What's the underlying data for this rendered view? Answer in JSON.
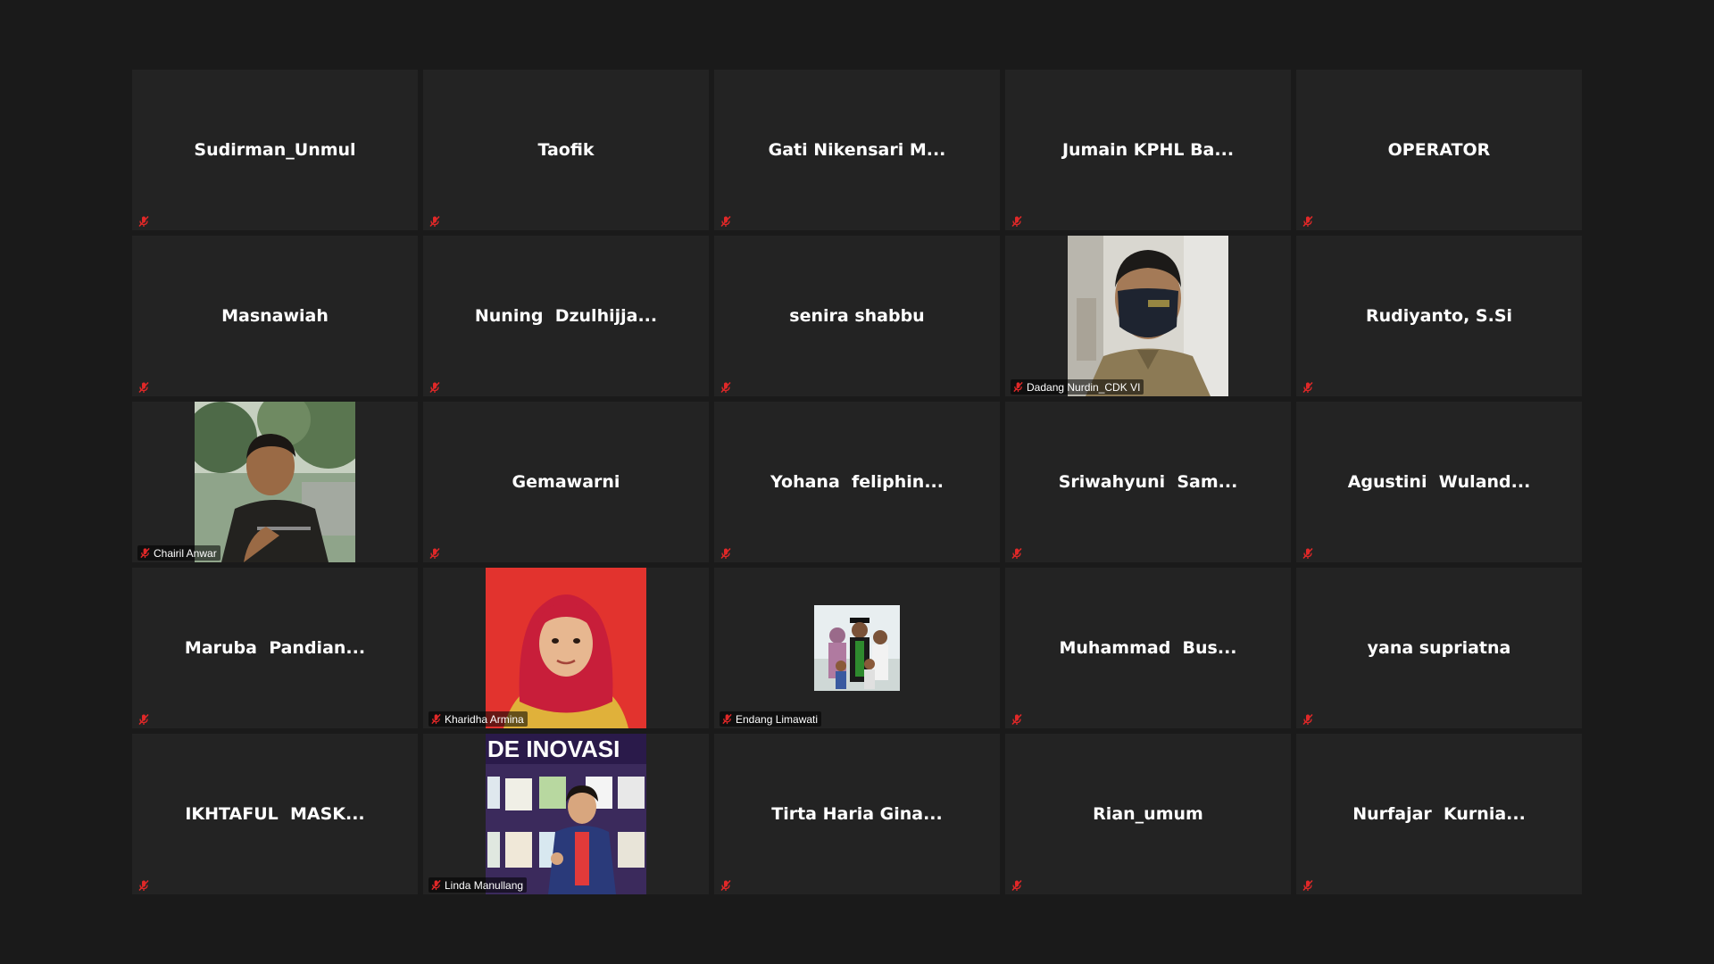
{
  "participants": [
    {
      "name": "Sudirman_Unmul"
    },
    {
      "name": "Taofik"
    },
    {
      "name": "Gati Nikensari M..."
    },
    {
      "name": "Jumain KPHL Ba..."
    },
    {
      "name": "OPERATOR"
    },
    {
      "name": "Masnawiah"
    },
    {
      "name": "Nuning  Dzulhijja..."
    },
    {
      "name": "senira shabbu"
    },
    {
      "name": "Dadang Nurdin_CDK VI",
      "video": "man-mask-photo"
    },
    {
      "name": "Rudiyanto, S.Si"
    },
    {
      "name": "Chairil Anwar",
      "video": "man-outdoor-photo"
    },
    {
      "name": "Gemawarni"
    },
    {
      "name": "Yohana  feliphin..."
    },
    {
      "name": "Sriwahyuni  Sam..."
    },
    {
      "name": "Agustini  Wuland..."
    },
    {
      "name": "Maruba  Pandian..."
    },
    {
      "name": "Kharidha Armina",
      "video": "woman-hijab-photo"
    },
    {
      "name": "Endang Limawati",
      "video": "family-photo"
    },
    {
      "name": "Muhammad  Bus..."
    },
    {
      "name": "yana supriatna"
    },
    {
      "name": "IKHTAFUL  MASK..."
    },
    {
      "name": "Linda Manullang",
      "video": "expo-booth-photo",
      "banner_text": "DE INOVASI"
    },
    {
      "name": "Tirta Haria Gina..."
    },
    {
      "name": "Rian_umum"
    },
    {
      "name": "Nurfajar  Kurnia..."
    }
  ],
  "icons": {
    "muted": "muted-mic-icon"
  },
  "colors": {
    "background": "#1a1a1a",
    "tile": "#232323",
    "muted": "#e02828"
  }
}
